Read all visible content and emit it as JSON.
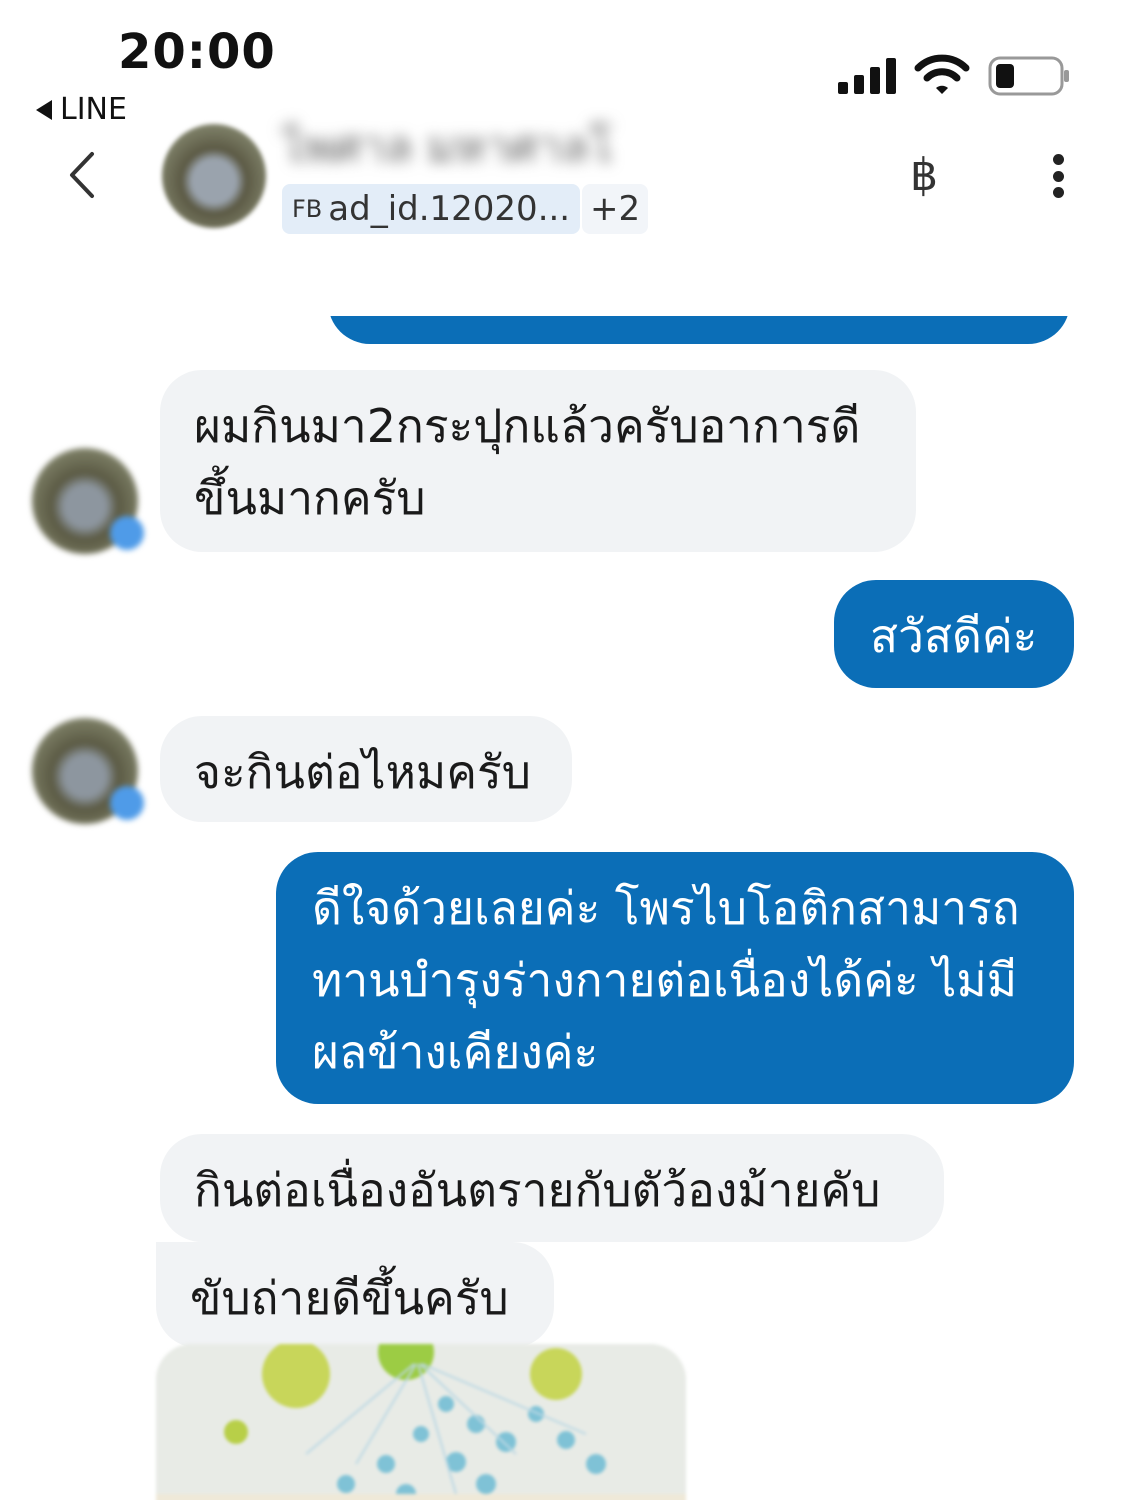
{
  "status_bar": {
    "time": "20:00",
    "back_app_label": "LINE",
    "icons": [
      "signal-icon",
      "wifi-icon",
      "battery-icon"
    ]
  },
  "header": {
    "contact_name": "ไพศาล มหาศาลโชติ",
    "tag_source": "FB",
    "tag_label": "ad_id.12020...",
    "more_tags": "+2",
    "icons": [
      "back-chevron-icon",
      "baht-icon",
      "more-vertical-icon"
    ]
  },
  "colors": {
    "outgoing_bubble": "#0b6eb7",
    "incoming_bubble": "#f1f3f5",
    "tag_background": "#e3edf8"
  },
  "messages": [
    {
      "direction": "in",
      "text": "ผมกินมา2กระปุกแล้วครับอาการดีขึ้นมากครับ"
    },
    {
      "direction": "out",
      "text": "สวัสดีค่ะ"
    },
    {
      "direction": "in",
      "text": "จะกินต่อไหมครับ"
    },
    {
      "direction": "out",
      "text": "ดีใจด้วยเลยค่ะ โพรไบโอติกสามารถทานบำรุงร่างกายต่อเนื่องได้ค่ะ ไม่มีผลข้างเคียงค่ะ"
    },
    {
      "direction": "in",
      "text": "กินต่อเนื่องอันตรายกับตัว้องม้ายคับ"
    },
    {
      "direction": "in",
      "text": "ขับถ่ายดีขึ้นครับ"
    }
  ]
}
